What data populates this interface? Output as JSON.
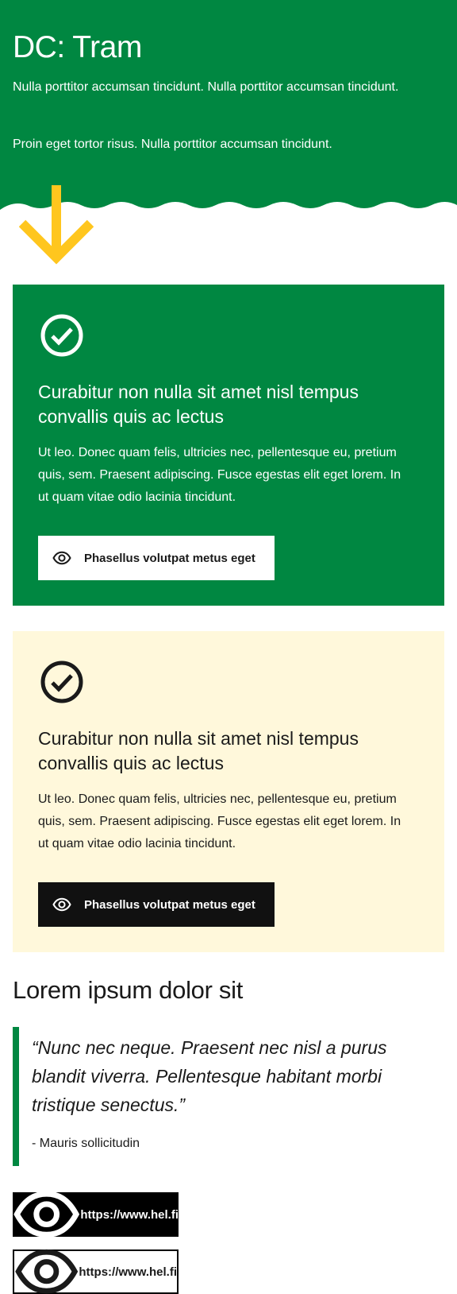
{
  "hero": {
    "title": "DC: Tram",
    "paragraph1": "Nulla porttitor accumsan tincidunt. Nulla porttitor accumsan tincidunt.",
    "paragraph2": "Proin eget tortor risus. Nulla porttitor accumsan tincidunt.",
    "background_color": "#008741",
    "arrow_color": "#ffc61e",
    "arrow_icon": "arrow-down-icon"
  },
  "cards": [
    {
      "variant": "green",
      "icon": "check-circle-icon",
      "title": "Curabitur non nulla sit amet nisl tempus convallis quis ac lectus",
      "body": "Ut leo. Donec quam felis, ultricies nec, pellentesque eu, pretium quis, sem. Praesent adipiscing. Fusce egestas elit eget lorem. In ut quam vitae odio lacinia tincidunt.",
      "button_label": "Phasellus volutpat metus eget",
      "button_icon": "eye-icon",
      "background_color": "#008741"
    },
    {
      "variant": "cream",
      "icon": "check-circle-icon",
      "title": "Curabitur non nulla sit amet nisl tempus convallis quis ac lectus",
      "body": "Ut leo. Donec quam felis, ultricies nec, pellentesque eu, pretium quis, sem. Praesent adipiscing. Fusce egestas elit eget lorem. In ut quam vitae odio lacinia tincidunt.",
      "button_label": "Phasellus volutpat metus eget",
      "button_icon": "eye-icon",
      "background_color": "#fff8db"
    }
  ],
  "quote_section": {
    "heading": "Lorem ipsum dolor sit",
    "quote": "“Nunc nec neque. Praesent nec nisl a purus blandit viverra. Pellentesque habitant morbi tristique senectus.”",
    "citation": "- Mauris sollicitudin",
    "border_color": "#008741"
  },
  "links": [
    {
      "label": "https://www.hel.fi",
      "style": "dark",
      "icon": "eye-icon"
    },
    {
      "label": "https://www.hel.fi",
      "style": "outline",
      "icon": "eye-icon"
    }
  ]
}
